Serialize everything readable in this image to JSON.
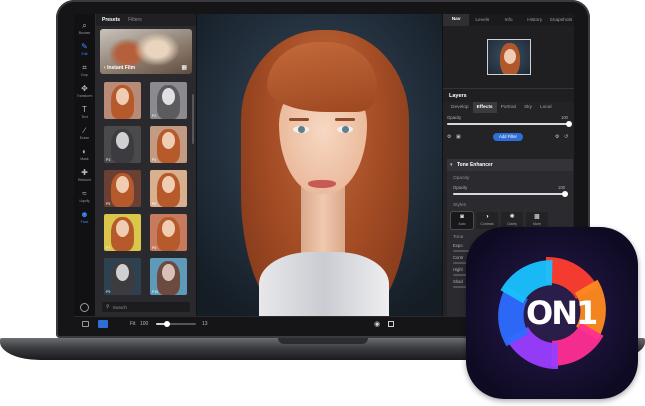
{
  "left_toolbar": {
    "tools": [
      {
        "icon": "browse-icon",
        "label": "Browse",
        "active": false
      },
      {
        "icon": "edit-icon",
        "label": "Edit",
        "active": true
      },
      {
        "icon": "crop-icon",
        "label": "Crop",
        "active": false
      },
      {
        "icon": "transform-icon",
        "label": "Transform",
        "active": false
      },
      {
        "icon": "text-icon",
        "label": "Text",
        "active": false
      },
      {
        "icon": "brush-icon",
        "label": "Erase",
        "active": false
      },
      {
        "icon": "mask-icon",
        "label": "Mask",
        "active": false
      },
      {
        "icon": "retouch-icon",
        "label": "Retouch",
        "active": false
      },
      {
        "icon": "liquify-icon",
        "label": "Liquify",
        "active": false
      },
      {
        "icon": "people-icon",
        "label": "Face",
        "active": true
      }
    ]
  },
  "presets_panel": {
    "tabs": [
      "Presets",
      "Filters"
    ],
    "featured": "Instant Film",
    "thumbnails": [
      {
        "label": "",
        "tint": "#b98a76"
      },
      {
        "label": "P2",
        "tint": "#8b8b8f"
      },
      {
        "label": "P3",
        "tint": "#4a4a4d"
      },
      {
        "label": "P4",
        "tint": "#c29b82"
      },
      {
        "label": "P5",
        "tint": "#6b3f34"
      },
      {
        "label": "P6",
        "tint": "#d9b08e"
      },
      {
        "label": "P7",
        "tint": "#d9c64a"
      },
      {
        "label": "P8",
        "tint": "#c67b5e"
      },
      {
        "label": "P9",
        "tint": "#2e4150"
      },
      {
        "label": "P10",
        "tint": "#5f9bb8"
      }
    ],
    "search_placeholder": "Search"
  },
  "right_panel": {
    "tabs": [
      "Nav",
      "Levels",
      "Info",
      "History",
      "Snapshots"
    ],
    "active_tab": "Nav",
    "layers_title": "Layers",
    "effect_tabs": [
      "Develop",
      "Effects",
      "Portrait",
      "Sky",
      "Local"
    ],
    "active_effect_tab": "Effects",
    "opacity_label": "Opacity",
    "opacity_value": "100",
    "opacity_level": 1.0,
    "add_filter_label": "Add Filter",
    "tone_enhancer": {
      "title": "Tone Enhancer",
      "opacity_section": "Opacity",
      "opacity_label": "Opacity",
      "opacity_value": "100",
      "opacity_level": 1.0,
      "styles_section": "Styles",
      "styles": [
        {
          "label": "Auto",
          "icon": "auto-icon",
          "active": true
        },
        {
          "label": "Contrast",
          "icon": "contrast-icon",
          "active": false
        },
        {
          "label": "Clarity",
          "icon": "sun-icon",
          "active": false
        },
        {
          "label": "More",
          "icon": "image-icon",
          "active": false
        }
      ],
      "tone_section": "Tone",
      "tone_rows": [
        "Expo",
        "Contr",
        "Highl",
        "Shad"
      ]
    }
  },
  "bottom_bar": {
    "fit_label": "Fit",
    "zoom_value": "100",
    "zoom_level": 0.28,
    "size_value": "13"
  },
  "app_icon": {
    "logo_text": "ON1",
    "colors": [
      "#ff3d2e",
      "#ff8a1f",
      "#ff2d92",
      "#9b3dff",
      "#2e6bff",
      "#19c2ff"
    ]
  }
}
